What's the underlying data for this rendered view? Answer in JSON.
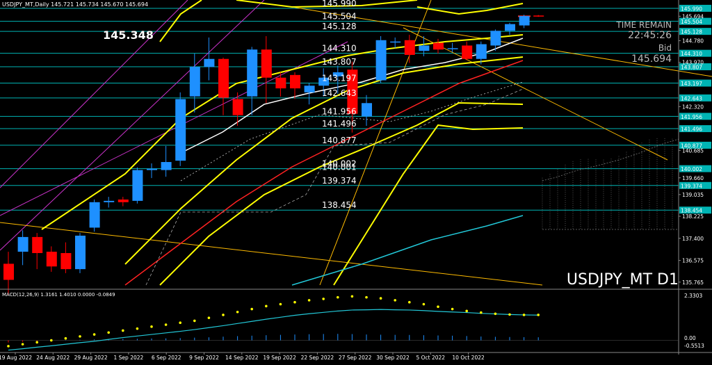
{
  "header": {
    "symbol_info": "USDJPY_MT,Daily  145.721 145.734 145.670 145.694",
    "big_price": "145.348",
    "time_remain_label": "TIME REMAIN",
    "time_remain_value": "22:45:26",
    "bid_label": "Bid",
    "bid_value": "145.694",
    "watermark": "USDJPY_MT D1"
  },
  "macd": {
    "label": "MACD(12,26,9) 1.3161 1.4010 0.0000 -0.0849",
    "scale_top": "2.3303",
    "scale_zero": "0.00",
    "scale_bottom": "-0.5513"
  },
  "colors": {
    "background": "#000000",
    "bull": "#1e90ff",
    "bear": "#ff0000",
    "levels": "#00b4b4",
    "yellow": "#ffff00",
    "magenta": "#cc33cc",
    "white": "#ffffff",
    "ma_red": "#ff2222",
    "ma_cyan": "#22c8d8"
  },
  "chart_data": {
    "type": "candlestick",
    "x_labels": [
      "19 Aug 2022",
      "24 Aug 2022",
      "29 Aug 2022",
      "1 Sep 2022",
      "6 Sep 2022",
      "9 Sep 2022",
      "14 Sep 2022",
      "19 Sep 2022",
      "22 Sep 2022",
      "27 Sep 2022",
      "30 Sep 2022",
      "5 Oct 2022",
      "10 Oct 2022"
    ],
    "y_ticks": [
      "145.990",
      "145.694",
      "145.504",
      "145.128",
      "144.780",
      "144.310",
      "143.970",
      "143.807",
      "143.197",
      "142.643",
      "142.320",
      "141.956",
      "141.496",
      "140.877",
      "140.685",
      "140.002",
      "139.660",
      "139.374",
      "139.035",
      "138.454",
      "138.225",
      "137.400",
      "136.575",
      "135.765"
    ],
    "y_range": [
      135.5,
      146.3
    ],
    "levels": [
      {
        "price": 145.99,
        "label": "145.990"
      },
      {
        "price": 145.504,
        "label": "145.504"
      },
      {
        "price": 145.128,
        "label": "145.128"
      },
      {
        "price": 144.31,
        "label": "144.310"
      },
      {
        "price": 143.807,
        "label": "143.807"
      },
      {
        "price": 143.197,
        "label": "143.197"
      },
      {
        "price": 142.643,
        "label": "142.643"
      },
      {
        "price": 141.956,
        "label": "141.956"
      },
      {
        "price": 141.496,
        "label": "141.496"
      },
      {
        "price": 140.877,
        "label": "140.877"
      },
      {
        "price": 140.002,
        "label": "140.002"
      },
      {
        "price": 139.374,
        "label": "139.374"
      },
      {
        "price": 138.454,
        "label": "138.454"
      }
    ],
    "overlap_label": "140.001",
    "candles": [
      {
        "open": 136.45,
        "high": 136.9,
        "low": 135.3,
        "close": 135.85
      },
      {
        "open": 136.9,
        "high": 137.7,
        "low": 136.4,
        "close": 137.45
      },
      {
        "open": 137.45,
        "high": 137.6,
        "low": 136.25,
        "close": 136.85
      },
      {
        "open": 136.9,
        "high": 137.1,
        "low": 136.15,
        "close": 136.35
      },
      {
        "open": 136.85,
        "high": 137.25,
        "low": 136.1,
        "close": 136.25
      },
      {
        "open": 136.25,
        "high": 137.6,
        "low": 136.1,
        "close": 137.5
      },
      {
        "open": 137.8,
        "high": 138.85,
        "low": 137.65,
        "close": 138.75
      },
      {
        "open": 138.75,
        "high": 138.95,
        "low": 138.55,
        "close": 138.8
      },
      {
        "open": 138.85,
        "high": 138.95,
        "low": 138.6,
        "close": 138.75
      },
      {
        "open": 138.8,
        "high": 140.05,
        "low": 138.7,
        "close": 139.95
      },
      {
        "open": 139.95,
        "high": 140.2,
        "low": 139.65,
        "close": 140.0
      },
      {
        "open": 139.95,
        "high": 140.85,
        "low": 139.7,
        "close": 140.25
      },
      {
        "open": 140.3,
        "high": 142.85,
        "low": 140.1,
        "close": 142.6
      },
      {
        "open": 142.7,
        "high": 144.3,
        "low": 142.1,
        "close": 143.8
      },
      {
        "open": 143.8,
        "high": 144.9,
        "low": 143.3,
        "close": 144.1
      },
      {
        "open": 144.1,
        "high": 144.15,
        "low": 142.0,
        "close": 142.65
      },
      {
        "open": 142.6,
        "high": 142.85,
        "low": 141.6,
        "close": 142.0
      },
      {
        "open": 142.7,
        "high": 144.55,
        "low": 142.0,
        "close": 144.45
      },
      {
        "open": 144.45,
        "high": 144.95,
        "low": 142.45,
        "close": 143.4
      },
      {
        "open": 143.4,
        "high": 143.6,
        "low": 142.7,
        "close": 143.0
      },
      {
        "open": 143.5,
        "high": 143.6,
        "low": 142.6,
        "close": 143.0
      },
      {
        "open": 142.85,
        "high": 143.2,
        "low": 142.4,
        "close": 143.1
      },
      {
        "open": 143.1,
        "high": 143.75,
        "low": 142.7,
        "close": 143.4
      },
      {
        "open": 143.45,
        "high": 143.85,
        "low": 142.8,
        "close": 143.6
      },
      {
        "open": 143.7,
        "high": 144.0,
        "low": 141.35,
        "close": 142.05
      },
      {
        "open": 141.95,
        "high": 142.75,
        "low": 141.6,
        "close": 142.45
      },
      {
        "open": 143.3,
        "high": 144.95,
        "low": 143.2,
        "close": 144.8
      },
      {
        "open": 144.75,
        "high": 144.9,
        "low": 144.5,
        "close": 144.75
      },
      {
        "open": 144.8,
        "high": 145.0,
        "low": 143.95,
        "close": 144.25
      },
      {
        "open": 144.4,
        "high": 144.95,
        "low": 144.2,
        "close": 144.6
      },
      {
        "open": 144.7,
        "high": 144.85,
        "low": 144.3,
        "close": 144.45
      },
      {
        "open": 144.5,
        "high": 144.7,
        "low": 144.35,
        "close": 144.5
      },
      {
        "open": 144.6,
        "high": 144.75,
        "low": 144.05,
        "close": 144.1
      },
      {
        "open": 144.1,
        "high": 144.75,
        "low": 143.9,
        "close": 144.65
      },
      {
        "open": 144.6,
        "high": 145.2,
        "low": 144.4,
        "close": 145.15
      },
      {
        "open": 145.15,
        "high": 145.45,
        "low": 145.0,
        "close": 145.4
      },
      {
        "open": 145.35,
        "high": 145.75,
        "low": 145.25,
        "close": 145.7
      },
      {
        "open": 145.72,
        "high": 145.74,
        "low": 145.67,
        "close": 145.69
      }
    ],
    "macd_histogram": [
      -0.45,
      -0.3,
      -0.15,
      0.02,
      0.05,
      0.1,
      0.18,
      0.22,
      0.28,
      0.32,
      0.38,
      0.4,
      0.45,
      0.55,
      0.62,
      0.75,
      0.86,
      0.95,
      1.05,
      1.12,
      1.2,
      1.25,
      1.3,
      1.32,
      1.28,
      1.2,
      1.15,
      1.12,
      1.1,
      1.05,
      1.0,
      0.95,
      0.88,
      0.78,
      0.72,
      0.68,
      0.65,
      0.62
    ],
    "macd_signal": [
      -0.5,
      -0.43,
      -0.35,
      -0.28,
      -0.2,
      -0.12,
      -0.05,
      0.05,
      0.14,
      0.22,
      0.3,
      0.38,
      0.46,
      0.55,
      0.65,
      0.75,
      0.86,
      0.97,
      1.08,
      1.18,
      1.28,
      1.36,
      1.43,
      1.5,
      1.55,
      1.56,
      1.58,
      1.56,
      1.55,
      1.52,
      1.48,
      1.45,
      1.42,
      1.38,
      1.35,
      1.32,
      1.3,
      1.29
    ],
    "macd_line": [
      -0.3,
      -0.2,
      -0.1,
      0.0,
      0.1,
      0.2,
      0.3,
      0.4,
      0.5,
      0.6,
      0.7,
      0.8,
      0.9,
      1.0,
      1.15,
      1.3,
      1.45,
      1.6,
      1.75,
      1.85,
      1.95,
      2.05,
      2.12,
      2.2,
      2.25,
      2.2,
      2.15,
      2.05,
      1.95,
      1.85,
      1.72,
      1.6,
      1.5,
      1.42,
      1.36,
      1.32,
      1.3,
      1.3
    ]
  }
}
